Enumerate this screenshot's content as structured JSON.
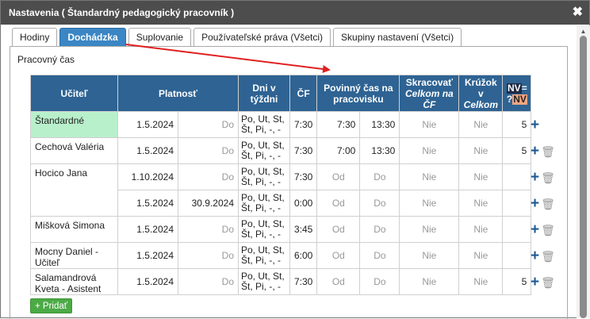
{
  "window": {
    "title": "Nastavenia ( Štandardný pedagogický pracovník )",
    "close_glyph": "✖"
  },
  "tabs": [
    {
      "label": "Hodiny",
      "active": false
    },
    {
      "label": "Dochádzka",
      "active": true
    },
    {
      "label": "Suplovanie",
      "active": false
    },
    {
      "label": "Používateľské práva (Všetci)",
      "active": false
    },
    {
      "label": "Skupiny nastavení (Všetci)",
      "active": false
    }
  ],
  "section": {
    "title": "Pracovný čas"
  },
  "table": {
    "headers": {
      "teacher": "Učiteľ",
      "validity": "Platnosť",
      "days": "Dni v týždni",
      "cf": "ČF",
      "required": "Povinný čas na pracovisku",
      "shorten_line1": "Skracovať",
      "shorten_line2": "Celkom na ČF",
      "club_line1": "Krúžok v",
      "club_line2": "Celkom",
      "nv_top": "NV",
      "nv_eq": "=",
      "nv_q": "?",
      "nv_bottom": "NV"
    },
    "rows": [
      {
        "teacher": "Štandardné",
        "from": "1.5.2024",
        "to": "Do",
        "days": "Po, Ut, St, Št, Pi, -, -",
        "cf": "7:30",
        "start": "7:30",
        "end": "13:30",
        "shorten": "Nie",
        "club": "Nie",
        "nv": "5"
      },
      {
        "teacher": "Cechová Valéria",
        "from": "1.5.2024",
        "to": "Do",
        "days": "Po, Ut, St, Št, Pi, -, -",
        "cf": "7:30",
        "start": "7:00",
        "end": "13:30",
        "shorten": "Nie",
        "club": "Nie",
        "nv": "5"
      },
      {
        "teacher": "Hocico Jana",
        "from": "1.10.2024",
        "to": "Do",
        "days": "Po, Ut, St, Št, Pi, -, -",
        "cf": "7:30",
        "start": "Od",
        "end": "Do",
        "shorten": "Nie",
        "club": "Nie",
        "nv": ""
      },
      {
        "teacher": "",
        "from": "1.5.2024",
        "to": "30.9.2024",
        "days": "Po, Ut, St, Št, Pi, -, -",
        "cf": "0:00",
        "start": "Od",
        "end": "Do",
        "shorten": "Nie",
        "club": "Nie",
        "nv": ""
      },
      {
        "teacher": "Mišková Simona",
        "from": "1.5.2024",
        "to": "Do",
        "days": "Po, Ut, St, Št, Pi, -, -",
        "cf": "3:45",
        "start": "Od",
        "end": "Do",
        "shorten": "Nie",
        "club": "Nie",
        "nv": ""
      },
      {
        "teacher": "Mocny Daniel - Učiteľ",
        "from": "1.5.2024",
        "to": "Do",
        "days": "Po, Ut, St, Št, Pi, -, -",
        "cf": "6:00",
        "start": "Od",
        "end": "Do",
        "shorten": "Nie",
        "club": "Nie",
        "nv": ""
      },
      {
        "teacher": "Salamandrová Kveta - Asistent",
        "from": "1.5.2024",
        "to": "Do",
        "days": "Po, Ut, St, Št, Pi, -, -",
        "cf": "7:30",
        "start": "Od",
        "end": "Do",
        "shorten": "Nie",
        "club": "Nie",
        "nv": "5"
      }
    ]
  },
  "actions": {
    "plus_glyph": "+",
    "trash_glyph": "🗑"
  },
  "add_button": {
    "label": "+ Pridať"
  },
  "scrollbar": {
    "up_glyph": "▲"
  },
  "colors": {
    "header_bg": "#2e6393",
    "active_tab": "#3b86c4",
    "standard_row": "#b8f0cc",
    "add_button": "#4caa46",
    "arrow": "#e02020"
  }
}
